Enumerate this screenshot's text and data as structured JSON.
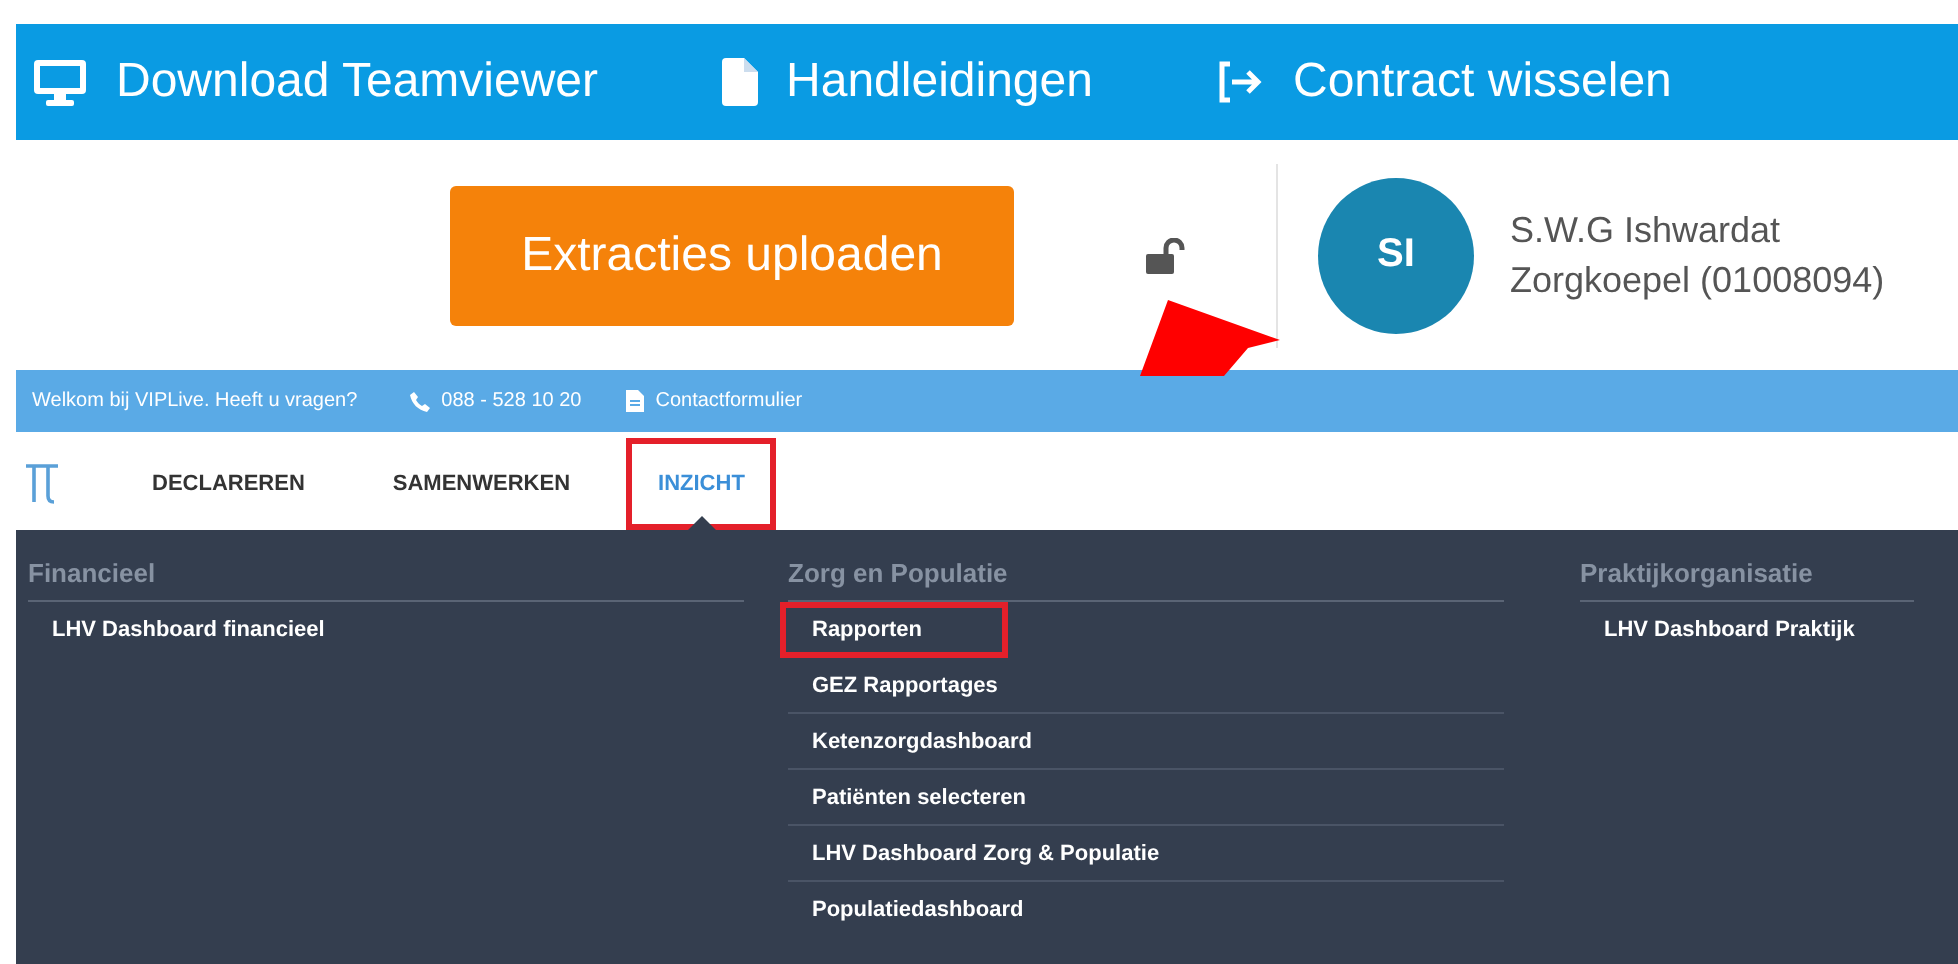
{
  "top_bar": {
    "links": [
      {
        "kind": "monitor",
        "label": "Download Teamviewer"
      },
      {
        "kind": "file",
        "label": "Handleidingen"
      },
      {
        "kind": "exit",
        "label": "Contract wisselen"
      }
    ]
  },
  "account": {
    "upload_button": "Extracties uploaden",
    "locked": false,
    "avatar": "SI",
    "name": "S.W.G Ishwardat",
    "organisation": "Zorgkoepel (01008094)"
  },
  "info_bar": {
    "welcome": "Welkom bij VIPLive. Heeft u vragen?",
    "phone": "088 - 528 10 20",
    "contact": "Contactformulier"
  },
  "nav": {
    "tabs": [
      {
        "label": "DECLAREREN",
        "selected": false,
        "highlighted": false
      },
      {
        "label": "SAMENWERKEN",
        "selected": false,
        "highlighted": false
      },
      {
        "label": "INZICHT",
        "selected": true,
        "highlighted": true
      }
    ]
  },
  "menu": {
    "columns": [
      {
        "title": "Financieel",
        "items": [
          {
            "label": "LHV Dashboard financieel",
            "highlighted": false
          }
        ]
      },
      {
        "title": "Zorg en Populatie",
        "items": [
          {
            "label": "Rapporten",
            "highlighted": true
          },
          {
            "label": "GEZ Rapportages",
            "highlighted": false
          },
          {
            "label": "Ketenzorgdashboard",
            "highlighted": false
          },
          {
            "label": "Patiënten selecteren",
            "highlighted": false
          },
          {
            "label": "LHV Dashboard Zorg & Populatie",
            "highlighted": false
          },
          {
            "label": "Populatiedashboard",
            "highlighted": false
          }
        ]
      },
      {
        "title": "Praktijkorganisatie",
        "items": [
          {
            "label": "LHV Dashboard Praktijk",
            "highlighted": false
          }
        ]
      }
    ]
  }
}
